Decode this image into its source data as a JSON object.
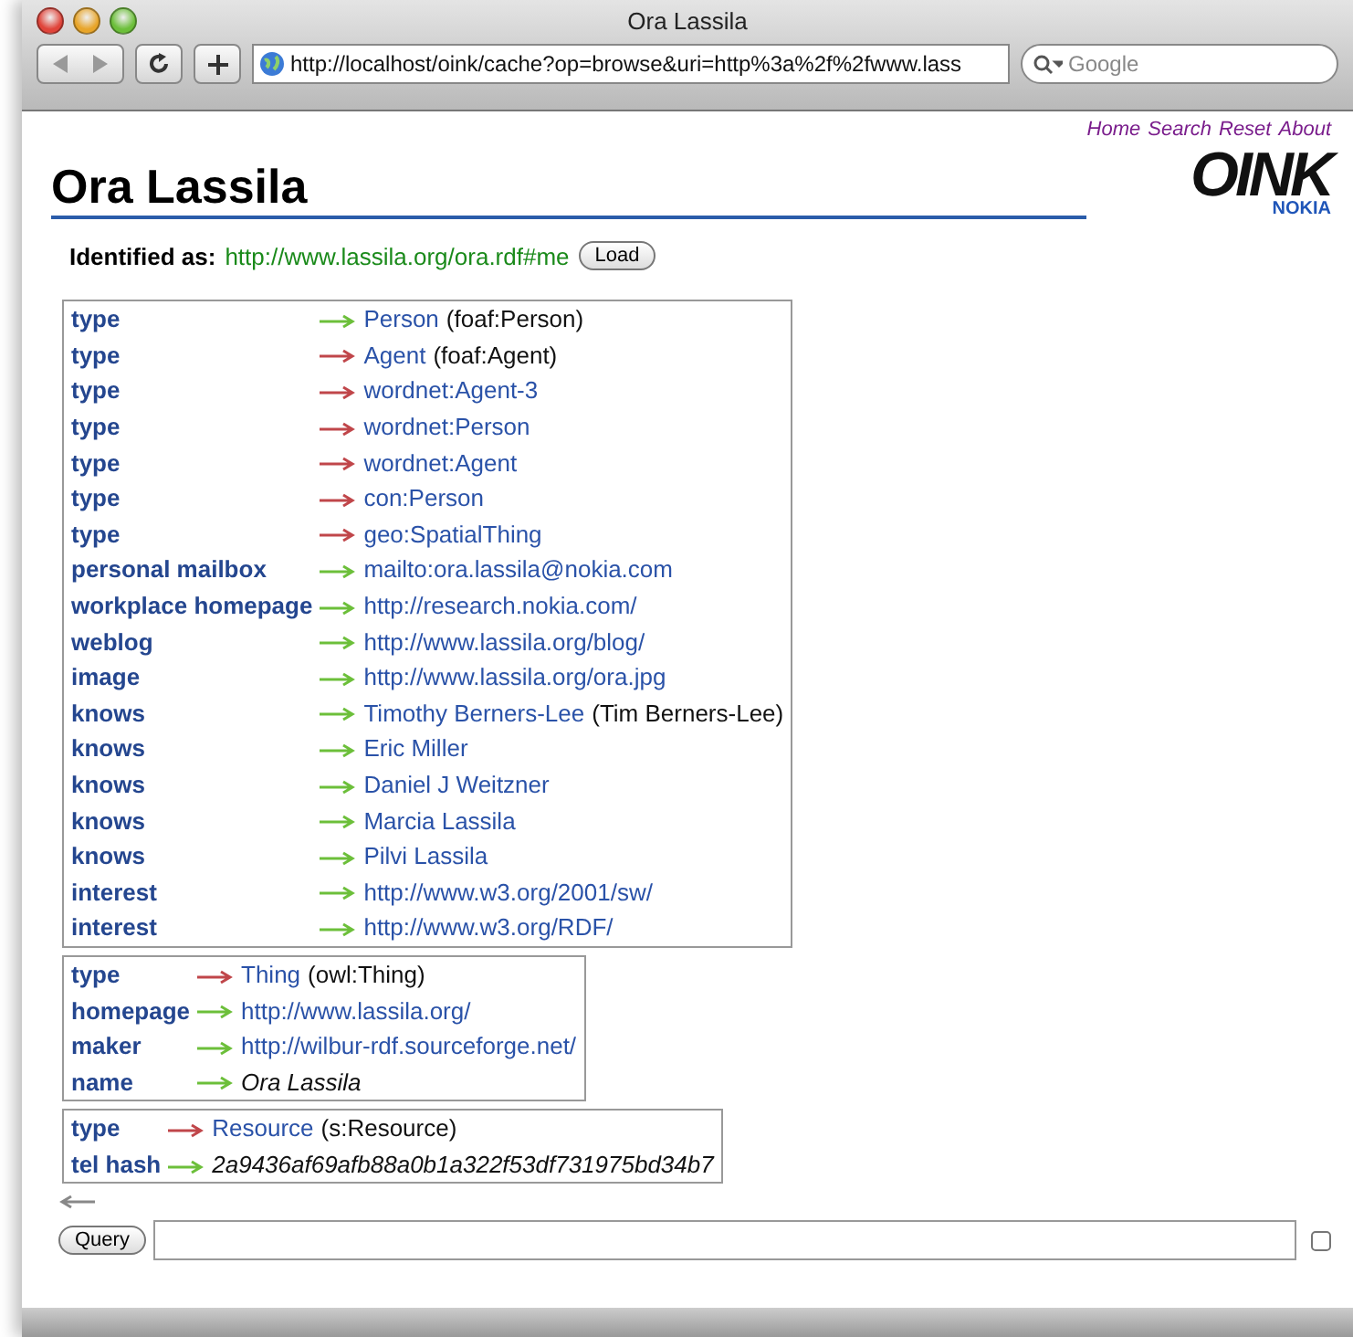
{
  "window": {
    "title": "Ora Lassila"
  },
  "toolbar": {
    "url": "http://localhost/oink/cache?op=browse&uri=http%3a%2f%2fwww.lass",
    "search_placeholder": "Google"
  },
  "nav_links": [
    "Home",
    "Search",
    "Reset",
    "About"
  ],
  "logo": {
    "text": "OINK",
    "subtext": "NOKIA"
  },
  "heading": "Ora Lassila",
  "identified": {
    "label": "Identified as:",
    "uri": "http://www.lassila.org/ora.rdf#me",
    "button": "Load"
  },
  "groups": [
    {
      "rows": [
        {
          "property": "type",
          "inferred": false,
          "kind": "link",
          "value": "Person",
          "note": "(foaf:Person)"
        },
        {
          "property": "type",
          "inferred": true,
          "kind": "link",
          "value": "Agent",
          "note": "(foaf:Agent)"
        },
        {
          "property": "type",
          "inferred": true,
          "kind": "link",
          "value": "wordnet:Agent-3"
        },
        {
          "property": "type",
          "inferred": true,
          "kind": "link",
          "value": "wordnet:Person"
        },
        {
          "property": "type",
          "inferred": true,
          "kind": "link",
          "value": "wordnet:Agent"
        },
        {
          "property": "type",
          "inferred": true,
          "kind": "link",
          "value": "con:Person"
        },
        {
          "property": "type",
          "inferred": true,
          "kind": "link",
          "value": "geo:SpatialThing"
        },
        {
          "property": "personal mailbox",
          "inferred": false,
          "kind": "link",
          "value": "mailto:ora.lassila@nokia.com"
        },
        {
          "property": "workplace homepage",
          "inferred": false,
          "kind": "link",
          "value": "http://research.nokia.com/"
        },
        {
          "property": "weblog",
          "inferred": false,
          "kind": "link",
          "value": "http://www.lassila.org/blog/"
        },
        {
          "property": "image",
          "inferred": false,
          "kind": "link",
          "value": "http://www.lassila.org/ora.jpg"
        },
        {
          "property": "knows",
          "inferred": false,
          "kind": "link",
          "value": "Timothy Berners-Lee",
          "note": "(Tim Berners-Lee)"
        },
        {
          "property": "knows",
          "inferred": false,
          "kind": "link",
          "value": "Eric Miller"
        },
        {
          "property": "knows",
          "inferred": false,
          "kind": "link",
          "value": "Daniel J Weitzner"
        },
        {
          "property": "knows",
          "inferred": false,
          "kind": "link",
          "value": "Marcia Lassila"
        },
        {
          "property": "knows",
          "inferred": false,
          "kind": "link",
          "value": "Pilvi Lassila"
        },
        {
          "property": "interest",
          "inferred": false,
          "kind": "link",
          "value": "http://www.w3.org/2001/sw/"
        },
        {
          "property": "interest",
          "inferred": false,
          "kind": "link",
          "value": "http://www.w3.org/RDF/"
        }
      ]
    },
    {
      "rows": [
        {
          "property": "type",
          "inferred": true,
          "kind": "link",
          "value": "Thing",
          "note": "(owl:Thing)"
        },
        {
          "property": "homepage",
          "inferred": false,
          "kind": "link",
          "value": "http://www.lassila.org/"
        },
        {
          "property": "maker",
          "inferred": false,
          "kind": "link",
          "value": "http://wilbur-rdf.sourceforge.net/"
        },
        {
          "property": "name",
          "inferred": false,
          "kind": "literal",
          "value": "Ora Lassila"
        }
      ]
    },
    {
      "rows": [
        {
          "property": "type",
          "inferred": true,
          "kind": "link",
          "value": "Resource",
          "note": "(s:Resource)"
        },
        {
          "property": "tel hash",
          "inferred": false,
          "kind": "literal",
          "value": "2a9436af69afb88a0b1a322f53df731975bd34b7"
        }
      ]
    }
  ],
  "query": {
    "button": "Query",
    "checked": false
  }
}
